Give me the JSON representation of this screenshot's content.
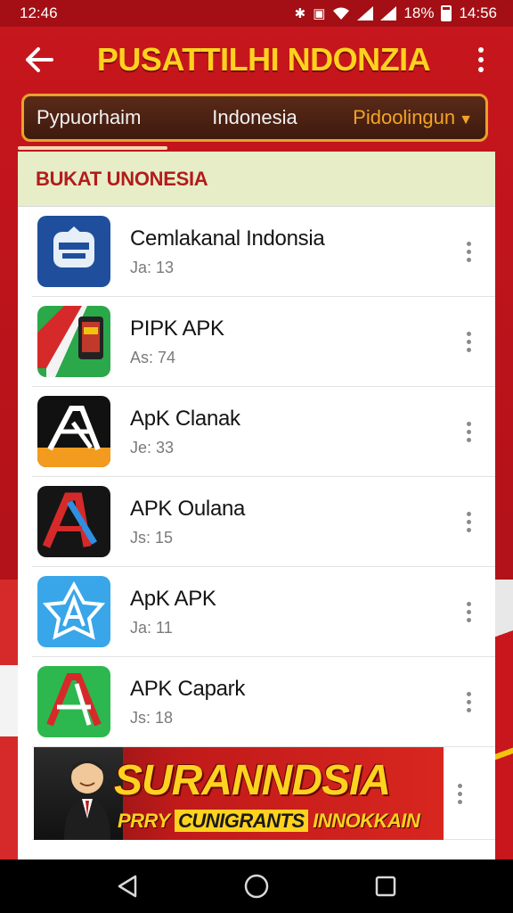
{
  "status_bar": {
    "time_left": "12:46",
    "battery_percent": "18%",
    "time_right": "14:56"
  },
  "app_bar": {
    "title": "PUSATTILHI NDONZIA"
  },
  "tabs": [
    {
      "label": "Pypuorhaim"
    },
    {
      "label": "Indonesia"
    },
    {
      "label": "Pidoolingun"
    }
  ],
  "section": {
    "title": "BUKAT UNONESIA"
  },
  "apps": [
    {
      "name": "Cemlakanal Indonsia",
      "meta": "Ja: 13"
    },
    {
      "name": "PIPK APK",
      "meta": "As: 74"
    },
    {
      "name": "ApK Clanak",
      "meta": "Je: 33"
    },
    {
      "name": "APK Oulana",
      "meta": "Js: 15"
    },
    {
      "name": "ApK APK",
      "meta": "Ja: 11"
    },
    {
      "name": "APK Capark",
      "meta": "Js: 18"
    }
  ],
  "banner": {
    "title": "SURANNDSIA",
    "sub_1": "PRRY",
    "sub_2": "CUNIGRANTS",
    "sub_3": "INNOKKAIN"
  },
  "colors": {
    "primary_red": "#c4161c",
    "title_yellow": "#ffd21f",
    "tab_accent": "#f2a424",
    "section_bg": "#e7edc7"
  }
}
